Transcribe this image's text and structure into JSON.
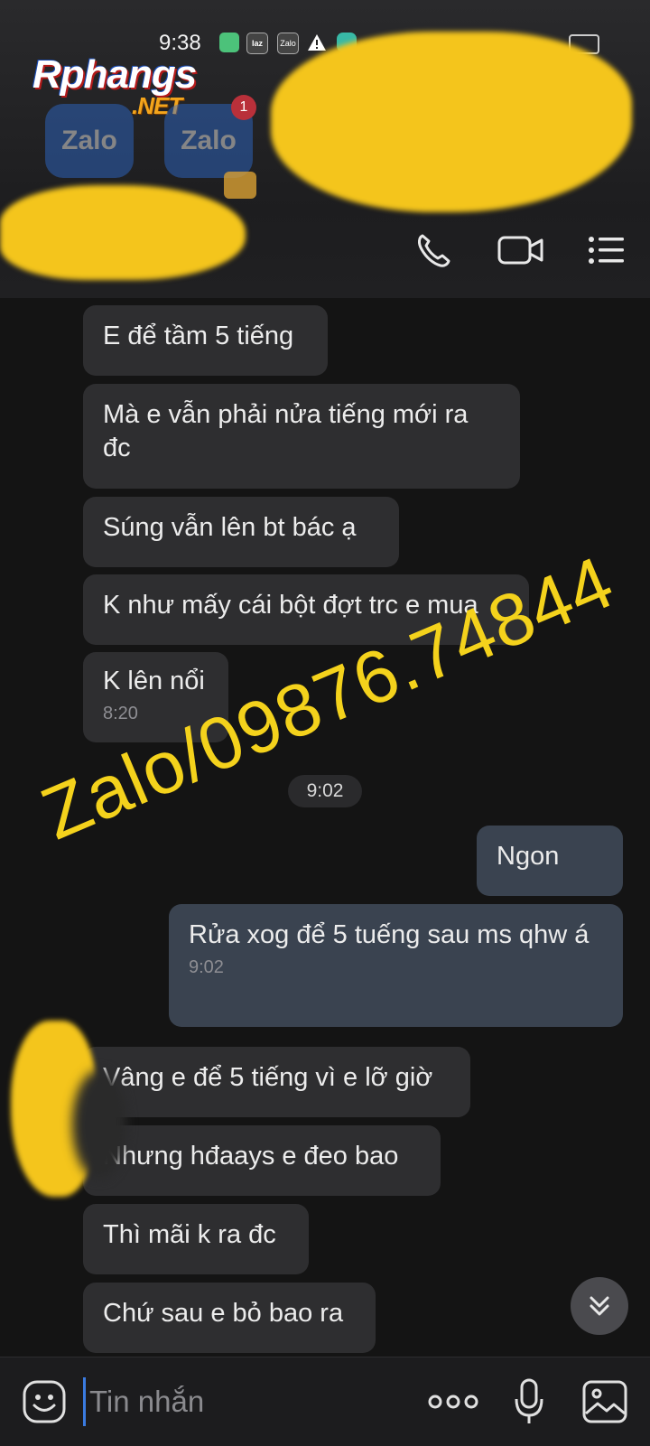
{
  "status_bar": {
    "time": "9:38",
    "notification_icons": [
      "message-icon",
      "lazada-icon",
      "zalo-icon",
      "warning-icon",
      "app-icon"
    ]
  },
  "watermark": {
    "logo_main": "Rphangs",
    "logo_suffix": ".NET",
    "phone_text": "Zalo/09876.74844"
  },
  "app_icons": [
    {
      "label": "Zalo"
    },
    {
      "label": "Zalo",
      "badge": "1"
    }
  ],
  "header": {
    "actions": [
      "call-icon",
      "video-call-icon",
      "menu-icon"
    ]
  },
  "messages": [
    {
      "text": "E để tầm 5 tiếng",
      "direction": "in"
    },
    {
      "text": "Mà e vẫn phải nửa tiếng mới ra đc",
      "direction": "in"
    },
    {
      "text": "Súng vẫn lên bt bác ạ",
      "direction": "in"
    },
    {
      "text": "K như mấy cái bột đợt trc e mua",
      "direction": "in"
    },
    {
      "text": "K lên nổi",
      "direction": "in",
      "time": "8:20"
    },
    {
      "text": "Ngon",
      "direction": "out"
    },
    {
      "text": "Rửa xog để 5 tuếng sau ms qhw á",
      "direction": "out",
      "time": "9:02"
    },
    {
      "text": "Vâng e để 5 tiếng vì e lỡ giờ",
      "direction": "in"
    },
    {
      "text": "Nhưng hđaays e đeo bao",
      "direction": "in"
    },
    {
      "text": "Thì mãi k ra đc",
      "direction": "in"
    },
    {
      "text": "Chứ sau e bỏ bao ra",
      "direction": "in"
    }
  ],
  "time_divider": "9:02",
  "composer": {
    "placeholder": "Tin nhắn"
  },
  "colors": {
    "background": "#141414",
    "incoming_bubble": "#2e2e30",
    "outgoing_bubble": "#3a4350",
    "watermark_yellow": "#f4d21c",
    "cursor_blue": "#3a7be0"
  }
}
